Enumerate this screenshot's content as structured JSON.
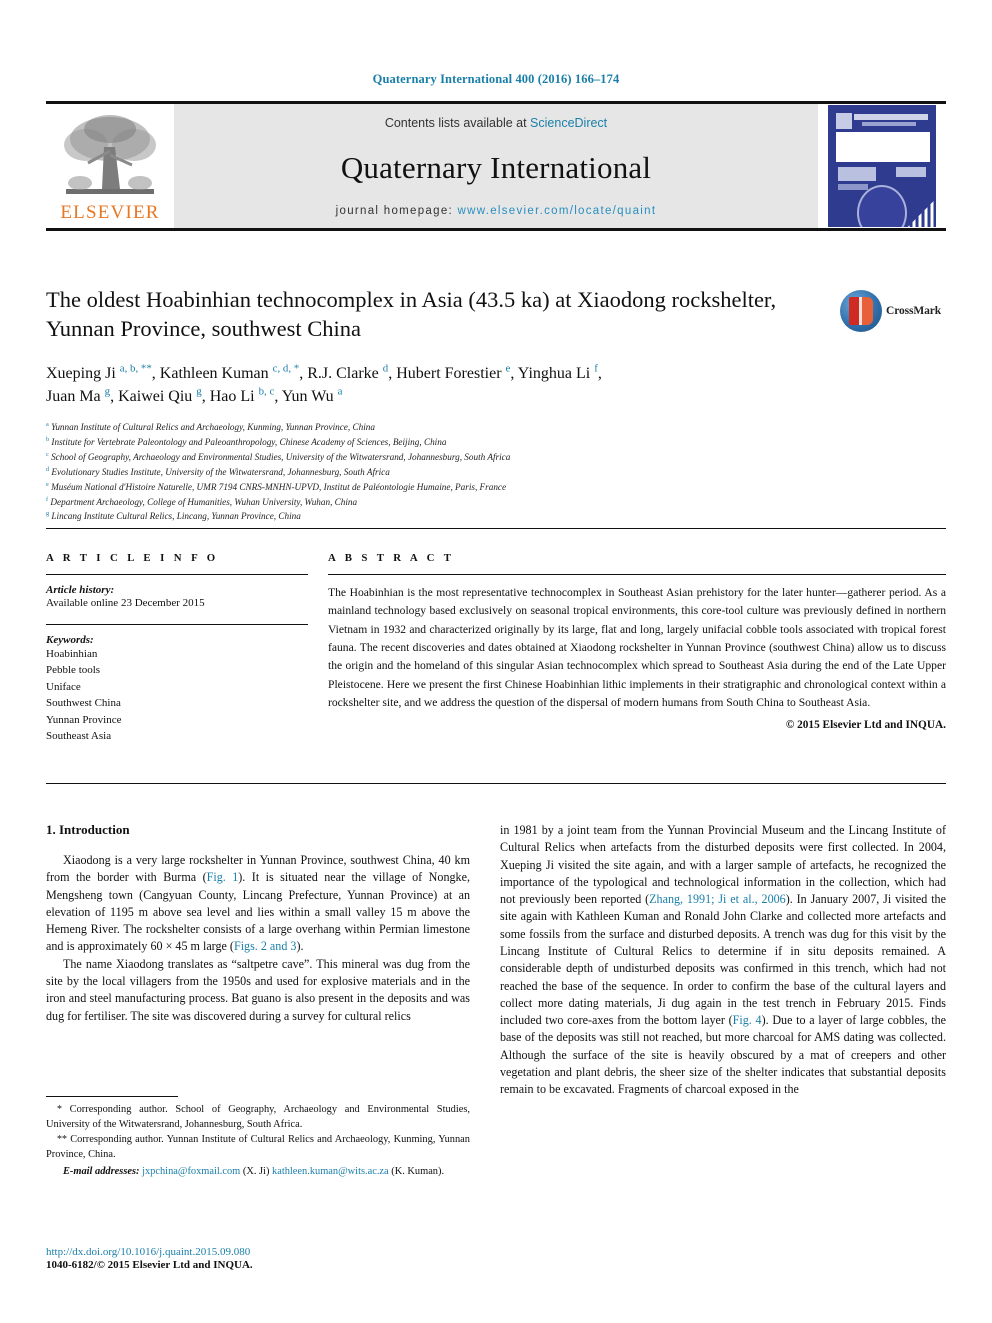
{
  "running_head": "Quaternary International 400 (2016) 166–174",
  "masthead": {
    "contents_prefix": "Contents lists available at ",
    "sciencedirect": "ScienceDirect",
    "journal_name": "Quaternary International",
    "homepage_prefix": "journal homepage: ",
    "homepage_url": "www.elsevier.com/locate/quaint",
    "publisher_wordmark": "ELSEVIER",
    "publisher_logo_icon": "elsevier-tree-icon",
    "cover_thumb_icon": "journal-cover-thumbnail"
  },
  "article": {
    "title": "The oldest Hoabinhian technocomplex in Asia (43.5 ka) at Xiaodong rockshelter, Yunnan Province, southwest China",
    "crossmark_label": "CrossMark",
    "crossmark_icon": "crossmark-logo-icon",
    "authors_line1_parts": [
      {
        "name": "Xueping Ji",
        "sup": "a, b, **"
      },
      {
        "name": "Kathleen Kuman",
        "sup": "c, d, *"
      },
      {
        "name": "R.J. Clarke",
        "sup": "d"
      },
      {
        "name": "Hubert Forestier",
        "sup": "e"
      },
      {
        "name": "Yinghua Li",
        "sup": "f"
      }
    ],
    "authors_line2_parts": [
      {
        "name": "Juan Ma",
        "sup": "g"
      },
      {
        "name": "Kaiwei Qiu",
        "sup": "g"
      },
      {
        "name": "Hao Li",
        "sup": "b, c"
      },
      {
        "name": "Yun Wu",
        "sup": "a"
      }
    ],
    "affiliations": [
      {
        "mark": "a",
        "text": "Yunnan Institute of Cultural Relics and Archaeology, Kunming, Yunnan Province, China"
      },
      {
        "mark": "b",
        "text": "Institute for Vertebrate Paleontology and Paleoanthropology, Chinese Academy of Sciences, Beijing, China"
      },
      {
        "mark": "c",
        "text": "School of Geography, Archaeology and Environmental Studies, University of the Witwatersrand, Johannesburg, South Africa"
      },
      {
        "mark": "d",
        "text": "Evolutionary Studies Institute, University of the Witwatersrand, Johannesburg, South Africa"
      },
      {
        "mark": "e",
        "text": "Muséum National d'Histoire Naturelle, UMR 7194 CNRS-MNHN-UPVD, Institut de Paléontologie Humaine, Paris, France"
      },
      {
        "mark": "f",
        "text": "Department Archaeology, College of Humanities, Wuhan University, Wuhan, China"
      },
      {
        "mark": "g",
        "text": "Lincang Institute Cultural Relics, Lincang, Yunnan Province, China"
      }
    ]
  },
  "article_info": {
    "heading": "A R T I C L E  I N F O",
    "history_label": "Article history:",
    "history_value": "Available online 23 December 2015",
    "keywords_label": "Keywords:",
    "keywords": [
      "Hoabinhian",
      "Pebble tools",
      "Uniface",
      "Southwest China",
      "Yunnan Province",
      "Southeast Asia"
    ]
  },
  "abstract": {
    "heading": "A B S T R A C T",
    "text": "The Hoabinhian is the most representative technocomplex in Southeast Asian prehistory for the later hunter—gatherer period. As a mainland technology based exclusively on seasonal tropical environments, this core-tool culture was previously defined in northern Vietnam in 1932 and characterized originally by its large, flat and long, largely unifacial cobble tools associated with tropical forest fauna. The recent discoveries and dates obtained at Xiaodong rockshelter in Yunnan Province (southwest China) allow us to discuss the origin and the homeland of this singular Asian technocomplex which spread to Southeast Asia during the end of the Late Upper Pleistocene. Here we present the first Chinese Hoabinhian lithic implements in their stratigraphic and chronological context within a rockshelter site, and we address the question of the dispersal of modern humans from South China to Southeast Asia.",
    "copyright": "© 2015 Elsevier Ltd and INQUA."
  },
  "body": {
    "section_heading": "1. Introduction",
    "left_paragraphs": [
      {
        "segments": [
          {
            "t": "Xiaodong is a very large rockshelter in Yunnan Province, southwest China, 40 km from the border with Burma (",
            "link": false
          },
          {
            "t": "Fig. 1",
            "link": true
          },
          {
            "t": "). It is situated near the village of Nongke, Mengsheng town (Cangyuan County, Lincang Prefecture, Yunnan Province) at an elevation of 1195 m above sea level and lies within a small valley 15 m above the Hemeng River. The rockshelter consists of a large overhang within Permian limestone and is approximately 60 × 45 m large (",
            "link": false
          },
          {
            "t": "Figs. 2 and 3",
            "link": true
          },
          {
            "t": ").",
            "link": false
          }
        ]
      },
      {
        "segments": [
          {
            "t": "The name Xiaodong translates as “saltpetre cave”. This mineral was dug from the site by the local villagers from the 1950s and used for explosive materials and in the iron and steel manufacturing process. Bat guano is also present in the deposits and was dug for fertiliser. The site was discovered during a survey for cultural relics",
            "link": false
          }
        ]
      }
    ],
    "right_paragraphs": [
      {
        "indent": false,
        "segments": [
          {
            "t": "in 1981 by a joint team from the Yunnan Provincial Museum and the Lincang Institute of Cultural Relics when artefacts from the disturbed deposits were first collected. In 2004, Xueping Ji visited the site again, and with a larger sample of artefacts, he recognized the importance of the typological and technological information in the collection, which had not previously been reported (",
            "link": false
          },
          {
            "t": "Zhang, 1991; Ji et al., 2006",
            "link": true
          },
          {
            "t": "). In January 2007, Ji visited the site again with Kathleen Kuman and Ronald John Clarke and collected more artefacts and some fossils from the surface and disturbed deposits. A trench was dug for this visit by the Lincang Institute of Cultural Relics to determine if in situ deposits remained. A considerable depth of undisturbed deposits was confirmed in this trench, which had not reached the base of the sequence. In order to confirm the base of the cultural layers and collect more dating materials, Ji dug again in the test trench in February 2015. Finds included two core-axes from the bottom layer (",
            "link": false
          },
          {
            "t": "Fig. 4",
            "link": true
          },
          {
            "t": "). Due to a layer of large cobbles, the base of the deposits was still not reached, but more charcoal for AMS dating was collected. Although the surface of the site is heavily obscured by a mat of creepers and other vegetation and plant debris, the sheer size of the shelter indicates that substantial deposits remain to be excavated. Fragments of charcoal exposed in the",
            "link": false
          }
        ]
      }
    ]
  },
  "footnotes": [
    {
      "mark": "*",
      "text": " Corresponding author. School of Geography, Archaeology and Environmental Studies, University of the Witwatersrand, Johannesburg, South Africa."
    },
    {
      "mark": "**",
      "text": " Corresponding author. Yunnan Institute of Cultural Relics and Archaeology, Kunming, Yunnan Province, China."
    }
  ],
  "email_note": {
    "label": "E-mail addresses:",
    "email1": "jxpchina@foxmail.com",
    "name1": "(X. Ji)",
    "email2": "kathleen.kuman@wits.ac.za",
    "name2": "(K. Kuman)."
  },
  "doi": {
    "url": "http://dx.doi.org/10.1016/j.quaint.2015.09.080",
    "issn_line": "1040-6182/© 2015 Elsevier Ltd and INQUA."
  },
  "colors": {
    "link": "#1a7fa8",
    "elsevier_orange": "#E87722",
    "masthead_grey": "#e6e6e6",
    "cover_blue": "#2e3b8f"
  }
}
